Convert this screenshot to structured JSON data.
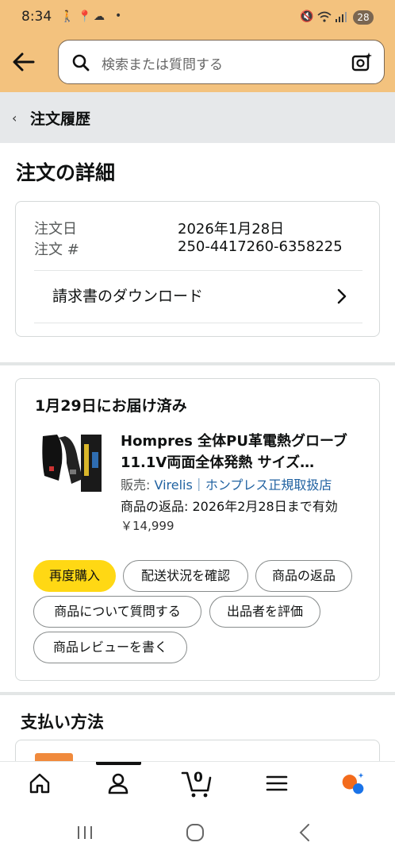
{
  "status_bar": {
    "time": "8:34",
    "battery": "28"
  },
  "search": {
    "placeholder": "検索または質問する"
  },
  "breadcrumb": {
    "label": "注文履歴"
  },
  "page": {
    "title": "注文の詳細"
  },
  "order_info": {
    "date_label": "注文日",
    "date_value": "2026年1月28日",
    "number_label": "注文 #",
    "number_value": "250-4417260-6358225",
    "invoice_label": "請求書のダウンロード"
  },
  "shipment": {
    "status": "1月29日にお届け済み",
    "product_name": "Hompres 全体PU革電熱グローブ 11.1V両面全体発熱 サイズ…",
    "seller_prefix": "販売: ",
    "seller_name": "Virelis｜ホンプレス正規取扱店",
    "return_text": "商品の返品: 2026年2月28日まで有効",
    "price": "￥14,999",
    "buttons": {
      "buy_again": "再度購入",
      "track": "配送状況を確認",
      "return": "商品の返品",
      "ask": "商品について質問する",
      "rate_seller": "出品者を評価",
      "review": "商品レビューを書く"
    }
  },
  "payment": {
    "title": "支払い方法"
  },
  "bottom_nav": {
    "cart_count": "0"
  },
  "colors": {
    "header": "#f3c27e",
    "accent": "#ffd814",
    "link": "#2162a1"
  }
}
